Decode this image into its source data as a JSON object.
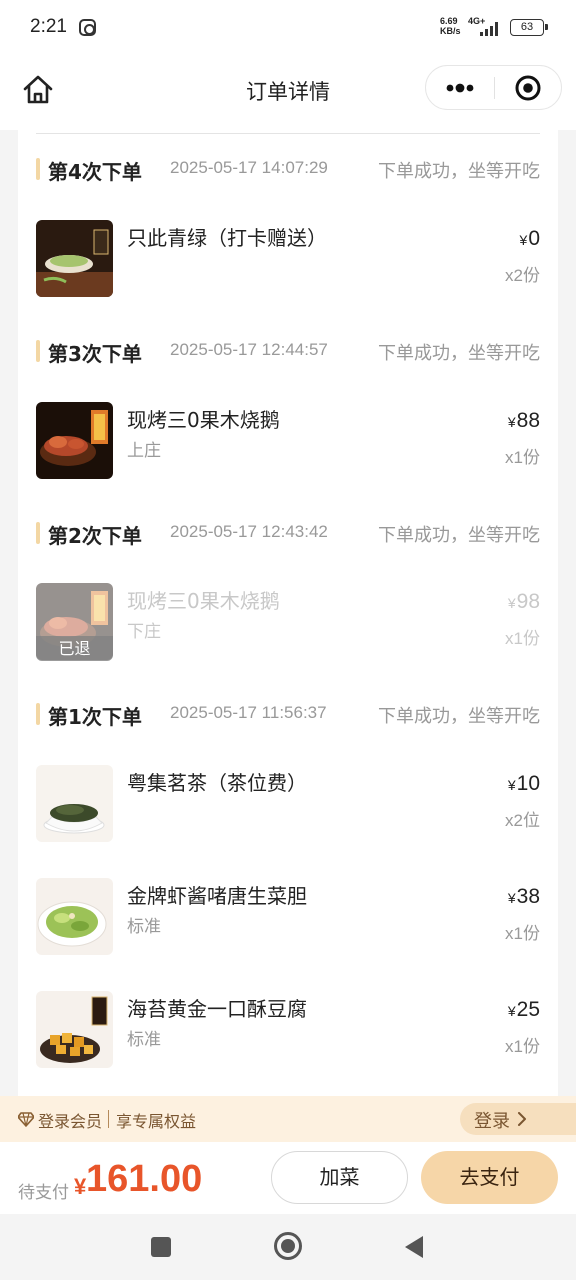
{
  "status_bar": {
    "time": "2:21",
    "net_speed_value": "6.69",
    "net_speed_unit": "KB/s",
    "network_type": "4G+",
    "battery": "63"
  },
  "header": {
    "title": "订单详情"
  },
  "orders": [
    {
      "title": "第4次下单",
      "time": "2025-05-17 14:07:29",
      "status": "下单成功，坐等开吃",
      "items": [
        {
          "name": "只此青绿（打卡赠送）",
          "spec": "",
          "currency": "¥",
          "price": "0",
          "qty": "x2份",
          "refunded": false,
          "icon": "green-tea-dessert-photo"
        }
      ]
    },
    {
      "title": "第3次下单",
      "time": "2025-05-17 12:44:57",
      "status": "下单成功，坐等开吃",
      "items": [
        {
          "name": "现烤三0果木烧鹅",
          "spec": "上庄",
          "currency": "¥",
          "price": "88",
          "qty": "x1份",
          "refunded": false,
          "icon": "roast-goose-photo"
        }
      ]
    },
    {
      "title": "第2次下单",
      "time": "2025-05-17 12:43:42",
      "status": "下单成功，坐等开吃",
      "items": [
        {
          "name": "现烤三0果木烧鹅",
          "spec": "下庄",
          "currency": "¥",
          "price": "98",
          "qty": "x1份",
          "refunded": true,
          "refund_label": "已退",
          "icon": "roast-goose-photo"
        }
      ]
    },
    {
      "title": "第1次下单",
      "time": "2025-05-17 11:56:37",
      "status": "下单成功，坐等开吃",
      "items": [
        {
          "name": "粤集茗茶（茶位费）",
          "spec": "",
          "currency": "¥",
          "price": "10",
          "qty": "x2位",
          "refunded": false,
          "icon": "tea-leaves-photo"
        },
        {
          "name": "金牌虾酱啫唐生菜胆",
          "spec": "标准",
          "currency": "¥",
          "price": "38",
          "qty": "x1份",
          "refunded": false,
          "icon": "lettuce-dish-photo"
        },
        {
          "name": "海苔黄金一口酥豆腐",
          "spec": "标准",
          "currency": "¥",
          "price": "25",
          "qty": "x1份",
          "refunded": false,
          "icon": "fried-tofu-photo"
        }
      ]
    }
  ],
  "member_banner": {
    "text1": "登录会员",
    "text2": "享专属权益",
    "login_label": "登录"
  },
  "pay_bar": {
    "label": "待支付",
    "currency": "¥",
    "amount": "161.00",
    "add_dish_label": "加菜",
    "pay_label": "去支付"
  },
  "colors": {
    "accent_price": "#e8552a",
    "pay_button": "#f6d6a8",
    "section_bar": "#f3d7a4",
    "member_bg": "#fdf1e0"
  }
}
